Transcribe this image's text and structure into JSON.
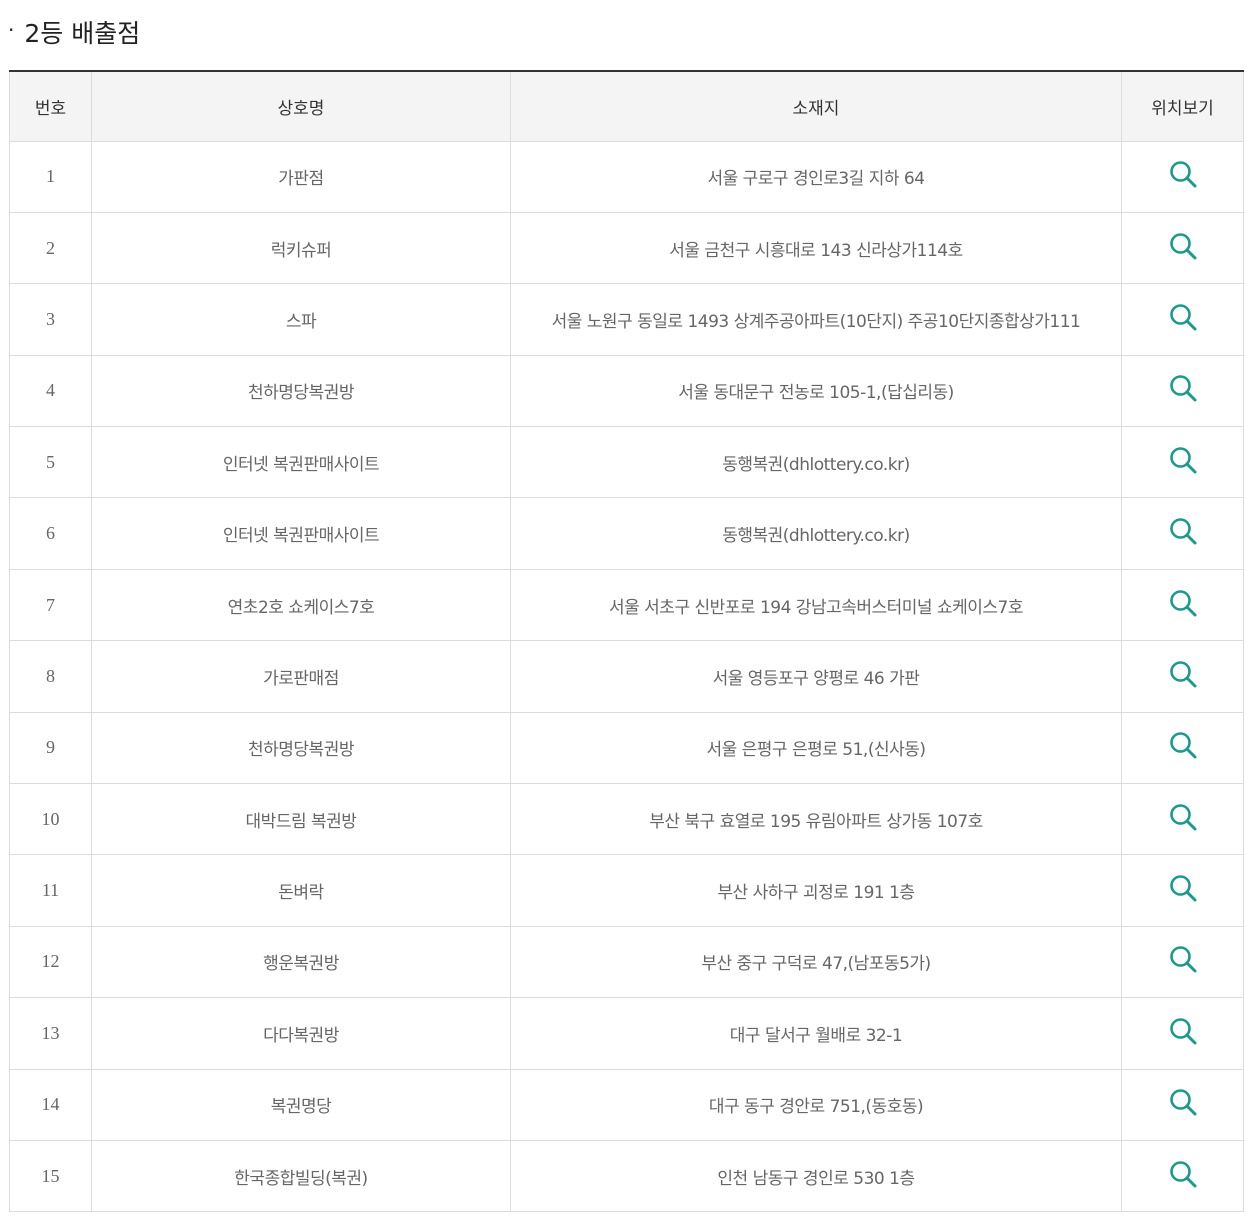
{
  "section": {
    "bullet": "·",
    "title": "2등 배출점"
  },
  "table": {
    "headers": {
      "no": "번호",
      "name": "상호명",
      "address": "소재지",
      "map": "위치보기"
    },
    "rows": [
      {
        "no": "1",
        "name": "가판점",
        "address": "서울 구로구 경인로3길 지하 64"
      },
      {
        "no": "2",
        "name": "럭키슈퍼",
        "address": "서울 금천구 시흥대로 143 신라상가114호"
      },
      {
        "no": "3",
        "name": "스파",
        "address": "서울 노원구 동일로 1493 상계주공아파트(10단지) 주공10단지종합상가111"
      },
      {
        "no": "4",
        "name": "천하명당복권방",
        "address": "서울 동대문구 전농로 105-1,(답십리동)"
      },
      {
        "no": "5",
        "name": "인터넷 복권판매사이트",
        "address": "동행복권(dhlottery.co.kr)"
      },
      {
        "no": "6",
        "name": "인터넷 복권판매사이트",
        "address": "동행복권(dhlottery.co.kr)"
      },
      {
        "no": "7",
        "name": "연초2호 쇼케이스7호",
        "address": "서울 서초구 신반포로 194 강남고속버스터미널 쇼케이스7호"
      },
      {
        "no": "8",
        "name": "가로판매점",
        "address": "서울 영등포구 양평로 46 가판"
      },
      {
        "no": "9",
        "name": "천하명당복권방",
        "address": "서울 은평구 은평로 51,(신사동)"
      },
      {
        "no": "10",
        "name": "대박드림 복권방",
        "address": "부산 북구 효열로 195 유림아파트 상가동 107호"
      },
      {
        "no": "11",
        "name": "돈벼락",
        "address": "부산 사하구 괴정로 191 1층"
      },
      {
        "no": "12",
        "name": "행운복권방",
        "address": "부산 중구 구덕로 47,(남포동5가)"
      },
      {
        "no": "13",
        "name": "다다복권방",
        "address": "대구 달서구 월배로 32-1"
      },
      {
        "no": "14",
        "name": "복권명당",
        "address": "대구 동구 경안로 751,(동호동)"
      },
      {
        "no": "15",
        "name": "한국종합빌딩(복권)",
        "address": "인천 남동구 경인로 530 1층"
      }
    ]
  },
  "icons": {
    "map_view": "search-icon"
  },
  "colors": {
    "icon": "#1a9a8a",
    "header_bg": "#f4f4f4",
    "border": "#dcdcdc",
    "top_border": "#333333"
  }
}
